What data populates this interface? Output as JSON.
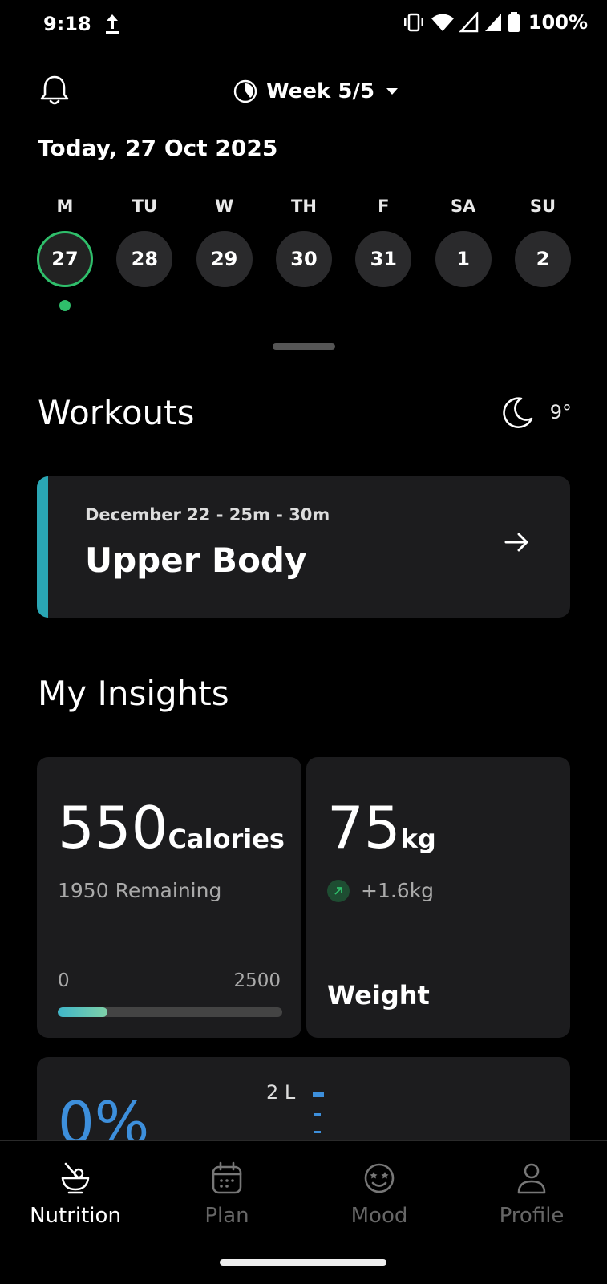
{
  "status_bar": {
    "time": "9:18",
    "battery": "100%"
  },
  "header": {
    "week_label": "Week 5/5",
    "today": "Today, 27 Oct 2025"
  },
  "week": {
    "days": [
      {
        "letter": "M",
        "date": "27",
        "selected": true
      },
      {
        "letter": "TU",
        "date": "28",
        "selected": false
      },
      {
        "letter": "W",
        "date": "29",
        "selected": false
      },
      {
        "letter": "TH",
        "date": "30",
        "selected": false
      },
      {
        "letter": "F",
        "date": "31",
        "selected": false
      },
      {
        "letter": "SA",
        "date": "1",
        "selected": false
      },
      {
        "letter": "SU",
        "date": "2",
        "selected": false
      }
    ]
  },
  "workouts": {
    "title": "Workouts",
    "temperature": "9°",
    "weather_icon": "moon-icon",
    "card": {
      "meta": "December 22 - 25m - 30m",
      "name": "Upper Body",
      "accent": "#2aa6b4"
    }
  },
  "insights": {
    "title": "My Insights",
    "calories": {
      "value": "550",
      "unit": "Calories",
      "remaining": "1950 Remaining",
      "min": "0",
      "max": "2500",
      "progress": 0.22
    },
    "weight": {
      "value": "75",
      "unit": "kg",
      "trend": "+1.6kg",
      "label": "Weight"
    },
    "water": {
      "percent": "0%",
      "goal": "2 L"
    }
  },
  "nav": {
    "items": [
      {
        "label": "Nutrition",
        "icon": "nutrition-bowl-icon",
        "active": true
      },
      {
        "label": "Plan",
        "icon": "calendar-icon",
        "active": false
      },
      {
        "label": "Mood",
        "icon": "mood-face-icon",
        "active": false
      },
      {
        "label": "Profile",
        "icon": "person-icon",
        "active": false
      }
    ]
  },
  "colors": {
    "accent_green": "#2fbf6b",
    "water_blue": "#3d8fdc",
    "card_bg": "#1c1c1e"
  }
}
